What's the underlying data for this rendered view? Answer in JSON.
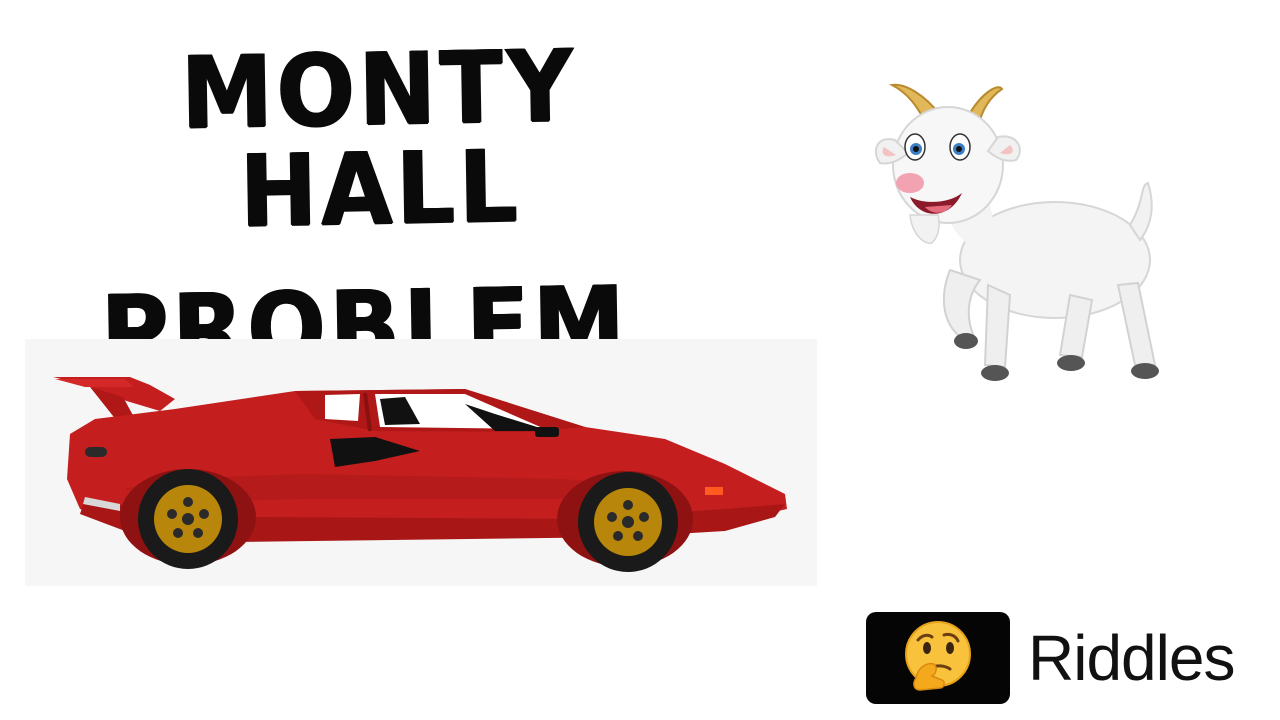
{
  "title": {
    "line1": "MONTY HALL",
    "line2": "PROBLEM"
  },
  "illustrations": {
    "car_icon": "sports-car-icon",
    "goat_icon": "goat-icon",
    "car_color": "#c41e1e",
    "wheel_color": "#b8860b",
    "goat_horn_color": "#e0b85a"
  },
  "badge": {
    "icon": "thinking-face-emoji-icon",
    "label": "Riddles"
  }
}
